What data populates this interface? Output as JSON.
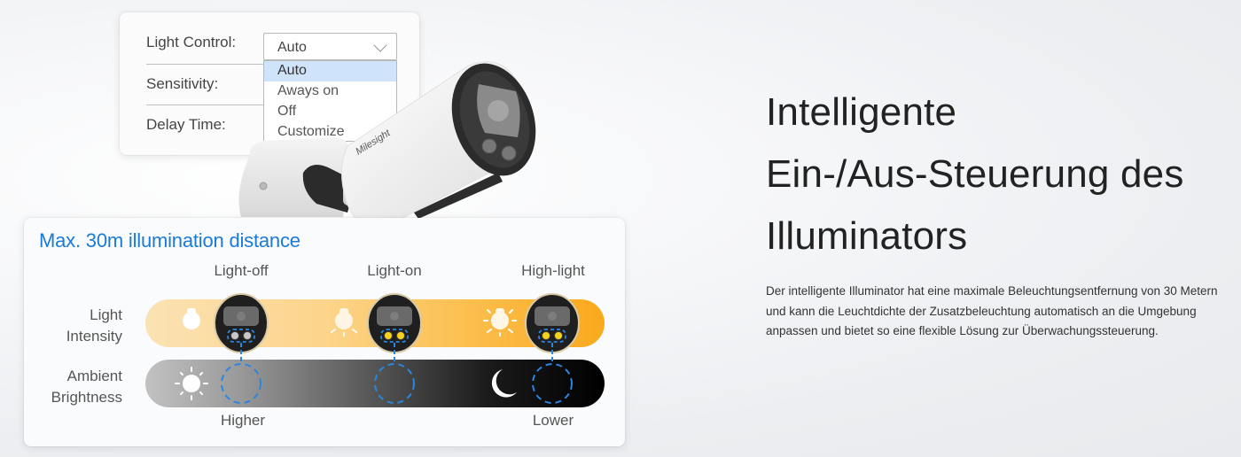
{
  "settings_panel": {
    "rows": [
      {
        "label": "Light Control:"
      },
      {
        "label": "Sensitivity:"
      },
      {
        "label": "Delay Time:"
      }
    ],
    "light_control_select": {
      "value": "Auto",
      "options": [
        "Auto",
        "Aways on",
        "Off",
        "Customize"
      ],
      "highlighted_index": 0
    }
  },
  "camera": {
    "brand": "Milesight"
  },
  "diagram": {
    "title": "Max. 30m illumination distance",
    "columns": [
      "Light-off",
      "Light-on",
      "High-light"
    ],
    "rows": [
      {
        "label_line1": "Light",
        "label_line2": "Intensity"
      },
      {
        "label_line1": "Ambient",
        "label_line2": "Brightness"
      }
    ],
    "bottom_labels": {
      "left": "Higher",
      "right": "Lower"
    },
    "colors": {
      "title": "#1a7ad6",
      "dashed_highlight": "#2a86e0",
      "led_on": "#f7d21a",
      "led_off": "#c8c8c8",
      "light_bar_start": "#fbe2b4",
      "light_bar_end": "#f9a91c",
      "ambient_bar_start": "#c2c2c2",
      "ambient_bar_end": "#000000"
    },
    "states": [
      {
        "column": "Light-off",
        "led": "off",
        "ambient_icon": "sun-icon"
      },
      {
        "column": "Light-on",
        "led": "on",
        "ambient_icon": "none"
      },
      {
        "column": "High-light",
        "led": "bright",
        "ambient_icon": "moon-icon"
      }
    ]
  },
  "headline": {
    "lines": [
      "Intelligente",
      "Ein-/Aus-Steuerung des",
      "Illuminators"
    ]
  },
  "description": "Der intelligente Illuminator hat eine maximale Beleuchtungsentfernung von 30 Metern und kann die Leuchtdichte der Zusatzbeleuchtung automatisch an die Umgebung anpassen und bietet so eine flexible Lösung zur Überwachungssteuerung."
}
